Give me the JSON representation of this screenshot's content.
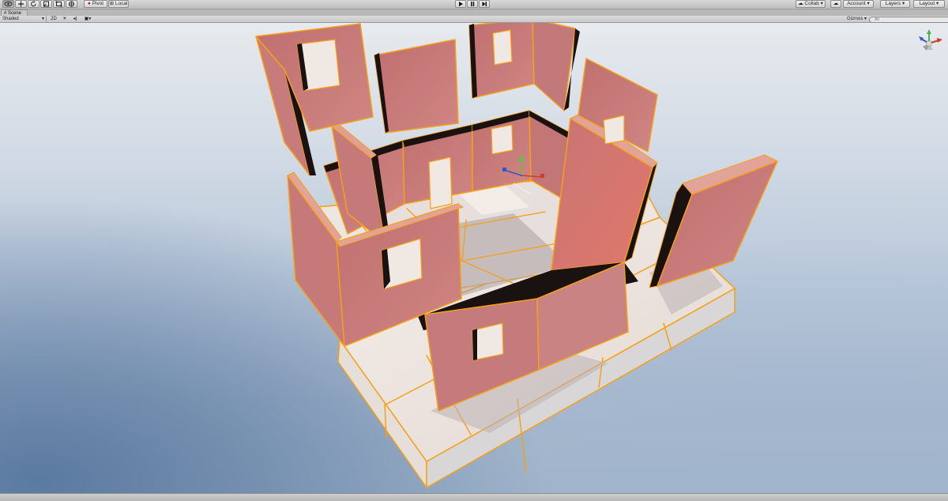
{
  "toolbar": {
    "tools": [
      "view-tool",
      "move-tool",
      "rotate-tool",
      "scale-tool",
      "rect-tool",
      "transform-tool"
    ],
    "pivot_label": "Pivot",
    "local_label": "Local",
    "collab_label": "Collab",
    "account_label": "Account",
    "layers_label": "Layers",
    "layout_label": "Layout",
    "dropdown_arrow": "▾"
  },
  "scene": {
    "tab_label": "Scene",
    "shading_mode": "Shaded",
    "toggle_2d": "2D",
    "gizmos_label": "Gizmos",
    "search_placeholder": "All"
  },
  "colors": {
    "wall": "#c97f7d",
    "wall_top": "#e2a399",
    "outline": "#f5a017",
    "floor": "#e9e1dc",
    "sky_dark": "#5b7aa0"
  }
}
